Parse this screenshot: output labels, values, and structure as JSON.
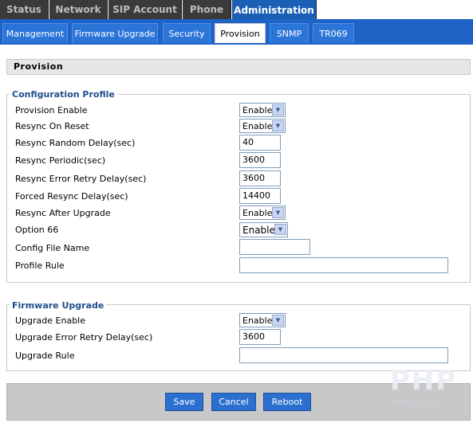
{
  "top_tabs": [
    "Status",
    "Network",
    "SIP Account",
    "Phone",
    "Administration"
  ],
  "sub_tabs": [
    "Management",
    "Firmware Upgrade",
    "Security",
    "Provision",
    "SNMP",
    "TR069"
  ],
  "section_title": "Provision",
  "config": {
    "legend": "Configuration Profile",
    "rows": [
      {
        "label": "Provision Enable",
        "value": "Enable"
      },
      {
        "label": "Resync On Reset",
        "value": "Enable"
      },
      {
        "label": "Resync Random Delay(sec)",
        "value": "40"
      },
      {
        "label": "Resync Periodic(sec)",
        "value": "3600"
      },
      {
        "label": "Resync Error Retry Delay(sec)",
        "value": "3600"
      },
      {
        "label": "Forced Resync Delay(sec)",
        "value": "14400"
      },
      {
        "label": "Resync After Upgrade",
        "value": "Enable"
      },
      {
        "label": "Option 66",
        "value": "Enable"
      },
      {
        "label": "Config File Name",
        "value": ""
      },
      {
        "label": "Profile Rule",
        "value": ""
      }
    ]
  },
  "firmware": {
    "legend": "Firmware Upgrade",
    "rows": [
      {
        "label": "Upgrade Enable",
        "value": "Enable"
      },
      {
        "label": "Upgrade Error Retry Delay(sec)",
        "value": "3600"
      },
      {
        "label": "Upgrade Rule",
        "value": ""
      }
    ]
  },
  "buttons": {
    "save": "Save",
    "cancel": "Cancel",
    "reboot": "Reboot"
  },
  "watermark": {
    "logo": "PHP",
    "text": "PHPCMS.CN"
  },
  "colors": {
    "accent": "#1f63c7",
    "active_tab": "#1a5fb4",
    "dark_tab": "#3a3a3a",
    "legend": "#1f4e8c"
  }
}
